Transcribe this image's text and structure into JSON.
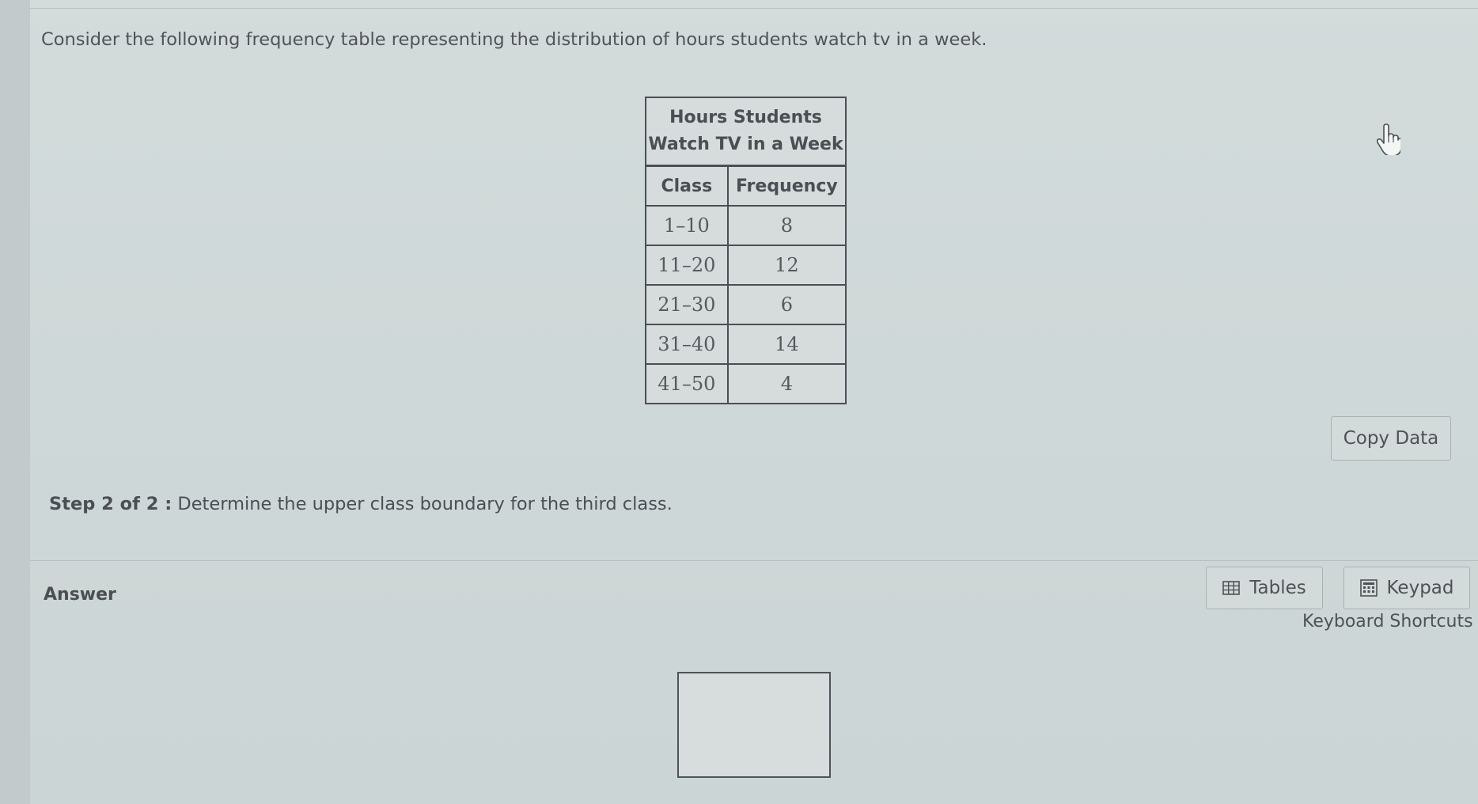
{
  "question": {
    "intro": "Consider the following frequency table representing the distribution of hours students watch tv in a week.",
    "step_label": "Step 2 of 2 :",
    "step_text": "Determine the upper class boundary for the third class."
  },
  "table": {
    "title": "Hours Students\nWatch TV in a Week",
    "headers": [
      "Class",
      "Frequency"
    ],
    "rows": [
      {
        "class": "1–10",
        "frequency": "8"
      },
      {
        "class": "11–20",
        "frequency": "12"
      },
      {
        "class": "21–30",
        "frequency": "6"
      },
      {
        "class": "31–40",
        "frequency": "14"
      },
      {
        "class": "41–50",
        "frequency": "4"
      }
    ]
  },
  "buttons": {
    "copy_data": "Copy Data",
    "tables": "Tables",
    "keypad": "Keypad",
    "keyboard_shortcuts": "Keyboard Shortcuts"
  },
  "answer": {
    "label": "Answer",
    "value": ""
  },
  "icons": {
    "cursor": "hand-pointer-icon",
    "tables": "table-grid-icon",
    "keypad": "keypad-icon"
  }
}
